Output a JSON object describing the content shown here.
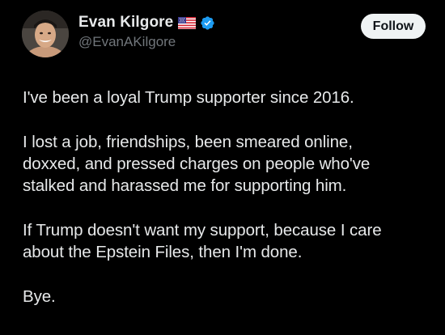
{
  "author": {
    "display_name": "Evan Kilgore",
    "handle": "@EvanAKilgore",
    "flag_icon": "us-flag-icon",
    "verified_icon": "verified-badge-icon",
    "verified_color": "#1d9bf0"
  },
  "actions": {
    "follow_label": "Follow"
  },
  "post": {
    "paragraphs": [
      {
        "lines": [
          "I've been a loyal Trump supporter since 2016."
        ]
      },
      {
        "lines": [
          "I lost a job, friendships, been smeared online,",
          "doxxed, and pressed charges on people who've",
          "stalked and harassed me for supporting him."
        ]
      },
      {
        "lines": [
          "If Trump doesn't want my support, because I care",
          "about the Epstein Files, then I'm done."
        ]
      },
      {
        "lines": [
          "Bye."
        ]
      }
    ]
  },
  "colors": {
    "background": "#000000",
    "text_primary": "#e7e9ea",
    "text_secondary": "#71767b",
    "follow_bg": "#eff3f4"
  }
}
